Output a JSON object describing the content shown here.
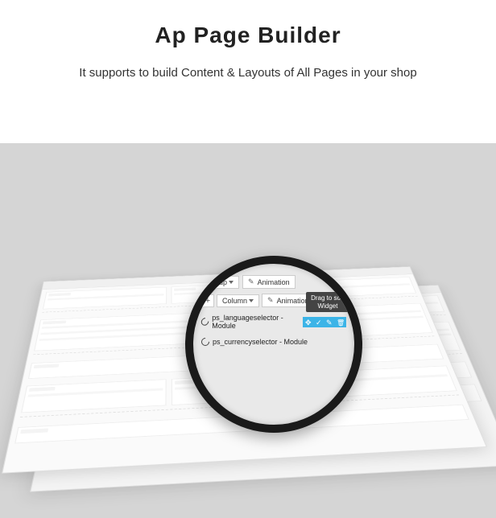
{
  "title": "Ap Page Builder",
  "subtitle": "It supports to build Content & Layouts of All Pages in your shop",
  "magnifier": {
    "group_btn": "Group",
    "animation_btn": "Animation",
    "column_btn": "Column",
    "tooltip": "Drag to sort Widget",
    "module1": "ps_languageselector - Module",
    "module2": "ps_currencyselector - Module"
  }
}
